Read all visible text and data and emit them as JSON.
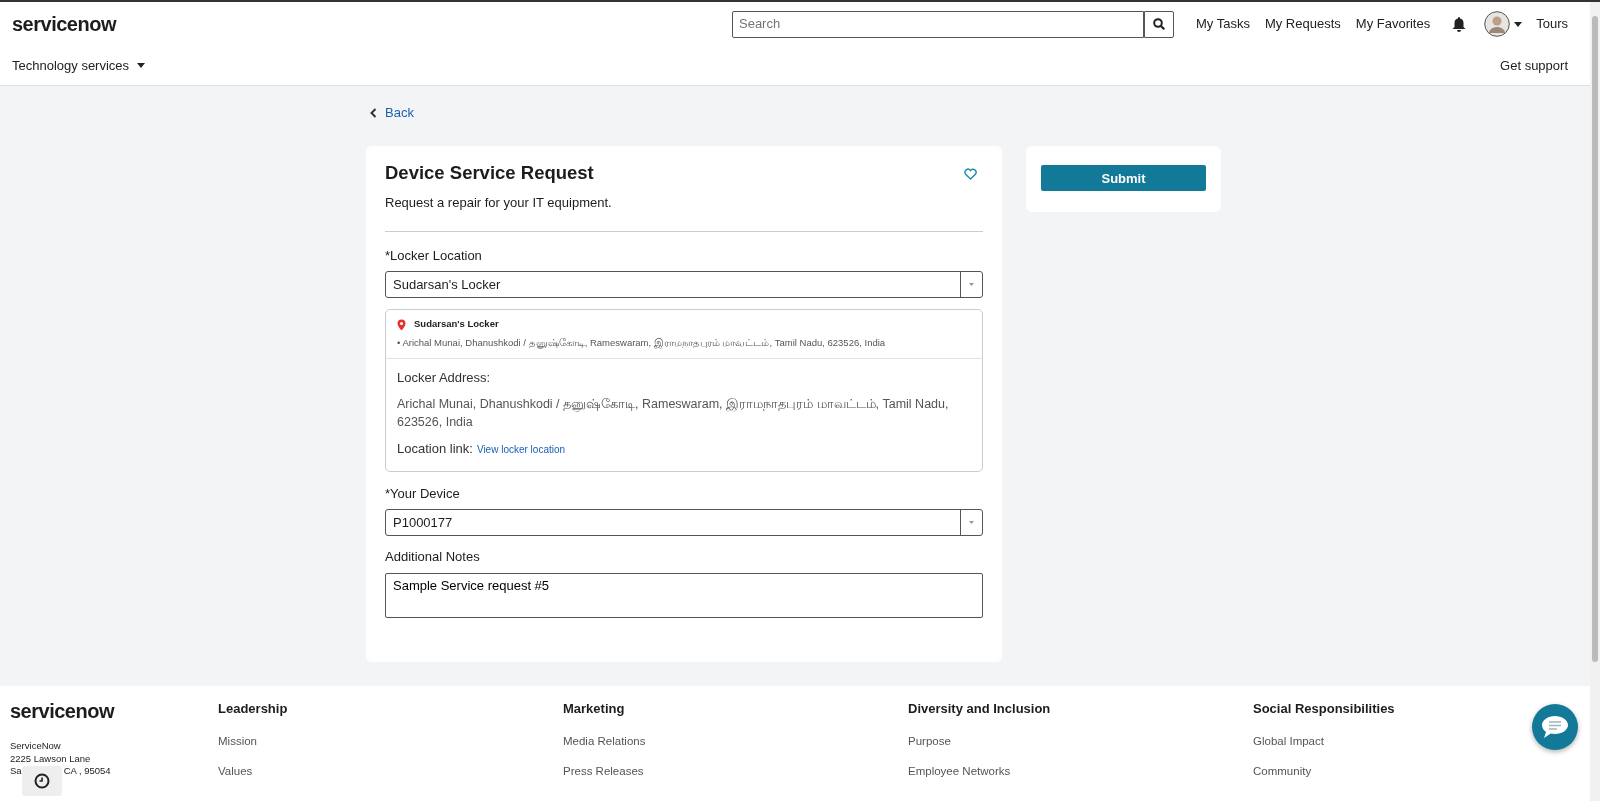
{
  "header": {
    "logo": "servicenow",
    "search": {
      "placeholder": "Search"
    },
    "nav_links": [
      "My Tasks",
      "My Requests",
      "My Favorites"
    ],
    "tours": "Tours"
  },
  "subnav": {
    "menu": "Technology services",
    "support": "Get support"
  },
  "back_link": "Back",
  "form": {
    "title": "Device Service Request",
    "description": "Request a repair for your IT equipment.",
    "favorited": false,
    "fields": [
      {
        "kind": "reference",
        "label": "Locker Location",
        "required_mark": "*",
        "value": "Sudarsan's Locker"
      },
      {
        "kind": "location",
        "name": "Sudarsan's Locker",
        "summary": "• Arichal Munai, Dhanushkodi / தனுஷ்கோடி, Rameswaram, இராமநாதபுரம் மாவட்டம், Tamil Nadu, 623526, India",
        "address_label": "Locker Address:",
        "address": "Arichal Munai, Dhanushkodi / தனுஷ்கோடி, Rameswaram, இராமநாதபுரம் மாவட்டம், Tamil Nadu, 623526, India",
        "link_label": "Location link:",
        "link": "View locker location"
      },
      {
        "kind": "reference",
        "label": "Your Device",
        "required_mark": "*",
        "value": "P1000177"
      },
      {
        "kind": "textarea",
        "label": "Additional Notes",
        "value": "Sample Service request #5"
      }
    ]
  },
  "submit": "Submit",
  "footer": {
    "logo": "servicenow",
    "address_lines": [
      "ServiceNow",
      "2225 Lawson Lane"
    ],
    "address_last_parts": [
      "Sa",
      "CA , 95054"
    ],
    "columns": [
      {
        "heading": "Leadership",
        "links": [
          "Mission",
          "Values"
        ]
      },
      {
        "heading": "Marketing",
        "links": [
          "Media Relations",
          "Press Releases"
        ]
      },
      {
        "heading": "Diversity and Inclusion",
        "links": [
          "Purpose",
          "Employee Networks"
        ]
      },
      {
        "heading": "Social Responsibilities",
        "links": [
          "Global Impact",
          "Community"
        ]
      }
    ]
  }
}
